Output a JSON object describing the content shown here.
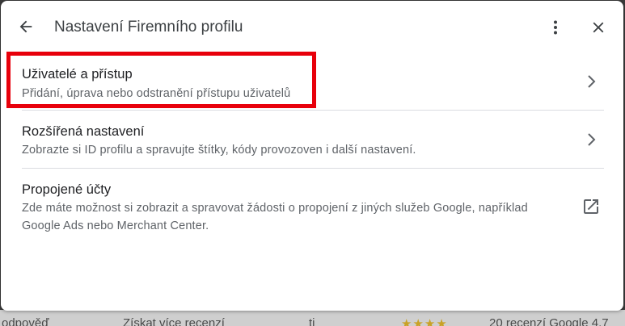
{
  "dialog": {
    "title": "Nastavení Firemního profilu"
  },
  "items": [
    {
      "title": "Uživatelé a přístup",
      "description": "Přidání, úprava nebo odstranění přístupu uživatelů",
      "icon": "chevron-right-icon"
    },
    {
      "title": "Rozšířená nastavení",
      "description": "Zobrazte si ID profilu a spravujte štítky, kódy provozoven i další nastavení.",
      "icon": "chevron-right-icon"
    },
    {
      "title": "Propojené účty",
      "description_line1": "Zde máte možnost si zobrazit a spravovat žádosti o propojení z jiných služeb Google, například",
      "description_line2": "Google Ads nebo Merchant Center.",
      "icon": "open-in-new-icon"
    }
  ],
  "background": {
    "text1": "odpověď",
    "text2": "Získat více recenzí",
    "text3": "ti",
    "text4": "★★★★",
    "text5": "20 recenzí Google  4,7"
  },
  "colors": {
    "highlight": "#e8000b",
    "icon": "#5f6368",
    "title": "#202124",
    "description": "#5f6368",
    "divider": "#dadce0"
  },
  "icons": {
    "back": "arrow-left-icon",
    "more": "more-vert-icon",
    "close": "close-icon"
  }
}
